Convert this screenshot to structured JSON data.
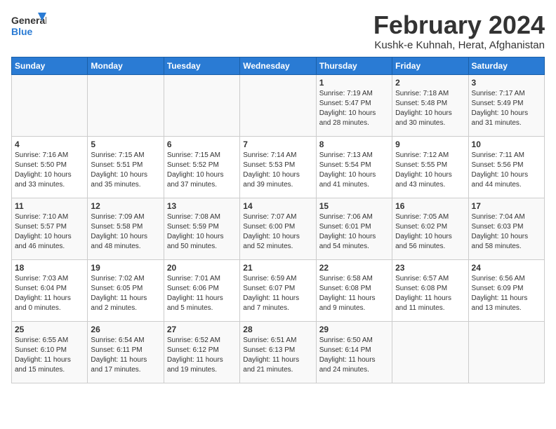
{
  "header": {
    "logo_general": "General",
    "logo_blue": "Blue",
    "month": "February 2024",
    "location": "Kushk-e Kuhnah, Herat, Afghanistan"
  },
  "days_of_week": [
    "Sunday",
    "Monday",
    "Tuesday",
    "Wednesday",
    "Thursday",
    "Friday",
    "Saturday"
  ],
  "weeks": [
    [
      {
        "day": "",
        "info": ""
      },
      {
        "day": "",
        "info": ""
      },
      {
        "day": "",
        "info": ""
      },
      {
        "day": "",
        "info": ""
      },
      {
        "day": "1",
        "info": "Sunrise: 7:19 AM\nSunset: 5:47 PM\nDaylight: 10 hours\nand 28 minutes."
      },
      {
        "day": "2",
        "info": "Sunrise: 7:18 AM\nSunset: 5:48 PM\nDaylight: 10 hours\nand 30 minutes."
      },
      {
        "day": "3",
        "info": "Sunrise: 7:17 AM\nSunset: 5:49 PM\nDaylight: 10 hours\nand 31 minutes."
      }
    ],
    [
      {
        "day": "4",
        "info": "Sunrise: 7:16 AM\nSunset: 5:50 PM\nDaylight: 10 hours\nand 33 minutes."
      },
      {
        "day": "5",
        "info": "Sunrise: 7:15 AM\nSunset: 5:51 PM\nDaylight: 10 hours\nand 35 minutes."
      },
      {
        "day": "6",
        "info": "Sunrise: 7:15 AM\nSunset: 5:52 PM\nDaylight: 10 hours\nand 37 minutes."
      },
      {
        "day": "7",
        "info": "Sunrise: 7:14 AM\nSunset: 5:53 PM\nDaylight: 10 hours\nand 39 minutes."
      },
      {
        "day": "8",
        "info": "Sunrise: 7:13 AM\nSunset: 5:54 PM\nDaylight: 10 hours\nand 41 minutes."
      },
      {
        "day": "9",
        "info": "Sunrise: 7:12 AM\nSunset: 5:55 PM\nDaylight: 10 hours\nand 43 minutes."
      },
      {
        "day": "10",
        "info": "Sunrise: 7:11 AM\nSunset: 5:56 PM\nDaylight: 10 hours\nand 44 minutes."
      }
    ],
    [
      {
        "day": "11",
        "info": "Sunrise: 7:10 AM\nSunset: 5:57 PM\nDaylight: 10 hours\nand 46 minutes."
      },
      {
        "day": "12",
        "info": "Sunrise: 7:09 AM\nSunset: 5:58 PM\nDaylight: 10 hours\nand 48 minutes."
      },
      {
        "day": "13",
        "info": "Sunrise: 7:08 AM\nSunset: 5:59 PM\nDaylight: 10 hours\nand 50 minutes."
      },
      {
        "day": "14",
        "info": "Sunrise: 7:07 AM\nSunset: 6:00 PM\nDaylight: 10 hours\nand 52 minutes."
      },
      {
        "day": "15",
        "info": "Sunrise: 7:06 AM\nSunset: 6:01 PM\nDaylight: 10 hours\nand 54 minutes."
      },
      {
        "day": "16",
        "info": "Sunrise: 7:05 AM\nSunset: 6:02 PM\nDaylight: 10 hours\nand 56 minutes."
      },
      {
        "day": "17",
        "info": "Sunrise: 7:04 AM\nSunset: 6:03 PM\nDaylight: 10 hours\nand 58 minutes."
      }
    ],
    [
      {
        "day": "18",
        "info": "Sunrise: 7:03 AM\nSunset: 6:04 PM\nDaylight: 11 hours\nand 0 minutes."
      },
      {
        "day": "19",
        "info": "Sunrise: 7:02 AM\nSunset: 6:05 PM\nDaylight: 11 hours\nand 2 minutes."
      },
      {
        "day": "20",
        "info": "Sunrise: 7:01 AM\nSunset: 6:06 PM\nDaylight: 11 hours\nand 5 minutes."
      },
      {
        "day": "21",
        "info": "Sunrise: 6:59 AM\nSunset: 6:07 PM\nDaylight: 11 hours\nand 7 minutes."
      },
      {
        "day": "22",
        "info": "Sunrise: 6:58 AM\nSunset: 6:08 PM\nDaylight: 11 hours\nand 9 minutes."
      },
      {
        "day": "23",
        "info": "Sunrise: 6:57 AM\nSunset: 6:08 PM\nDaylight: 11 hours\nand 11 minutes."
      },
      {
        "day": "24",
        "info": "Sunrise: 6:56 AM\nSunset: 6:09 PM\nDaylight: 11 hours\nand 13 minutes."
      }
    ],
    [
      {
        "day": "25",
        "info": "Sunrise: 6:55 AM\nSunset: 6:10 PM\nDaylight: 11 hours\nand 15 minutes."
      },
      {
        "day": "26",
        "info": "Sunrise: 6:54 AM\nSunset: 6:11 PM\nDaylight: 11 hours\nand 17 minutes."
      },
      {
        "day": "27",
        "info": "Sunrise: 6:52 AM\nSunset: 6:12 PM\nDaylight: 11 hours\nand 19 minutes."
      },
      {
        "day": "28",
        "info": "Sunrise: 6:51 AM\nSunset: 6:13 PM\nDaylight: 11 hours\nand 21 minutes."
      },
      {
        "day": "29",
        "info": "Sunrise: 6:50 AM\nSunset: 6:14 PM\nDaylight: 11 hours\nand 24 minutes."
      },
      {
        "day": "",
        "info": ""
      },
      {
        "day": "",
        "info": ""
      }
    ]
  ]
}
